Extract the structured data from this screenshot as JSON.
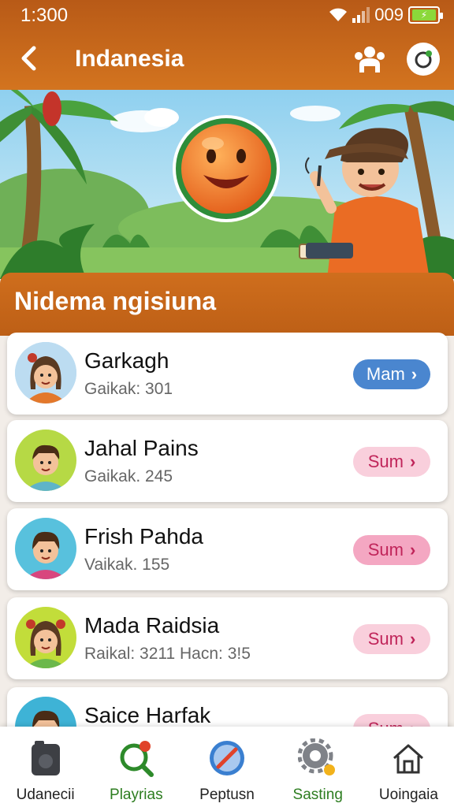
{
  "status_bar": {
    "time": "1:300",
    "battery_text": "009"
  },
  "header": {
    "title": "Indanesia"
  },
  "section": {
    "title": "Nidema ngisiuna"
  },
  "players": [
    {
      "name": "Garkagh",
      "sub": "Gaikak: 301",
      "action": "Mam",
      "style": "blue"
    },
    {
      "name": "Jahal Pains",
      "sub": "Gaikak. 245",
      "action": "Sum",
      "style": "pink"
    },
    {
      "name": "Frish Pahda",
      "sub": "Vaikak. 155",
      "action": "Sum",
      "style": "pink2"
    },
    {
      "name": "Mada Raidsia",
      "sub": "Raikal: 3211 Hacn: 3!5",
      "action": "Sum",
      "style": "pink"
    },
    {
      "name": "Saice Harfak",
      "sub": "",
      "action": "Sum",
      "style": "pink"
    }
  ],
  "bottom_nav": [
    {
      "label": "Udanecii",
      "icon": "camera-icon",
      "active": false
    },
    {
      "label": "Playrias",
      "icon": "search-icon",
      "active": true
    },
    {
      "label": "Peptusn",
      "icon": "compass-icon",
      "active": false
    },
    {
      "label": "Sasting",
      "icon": "gear-icon",
      "active": true
    },
    {
      "label": "Uoingaia",
      "icon": "home-icon",
      "active": false
    }
  ]
}
